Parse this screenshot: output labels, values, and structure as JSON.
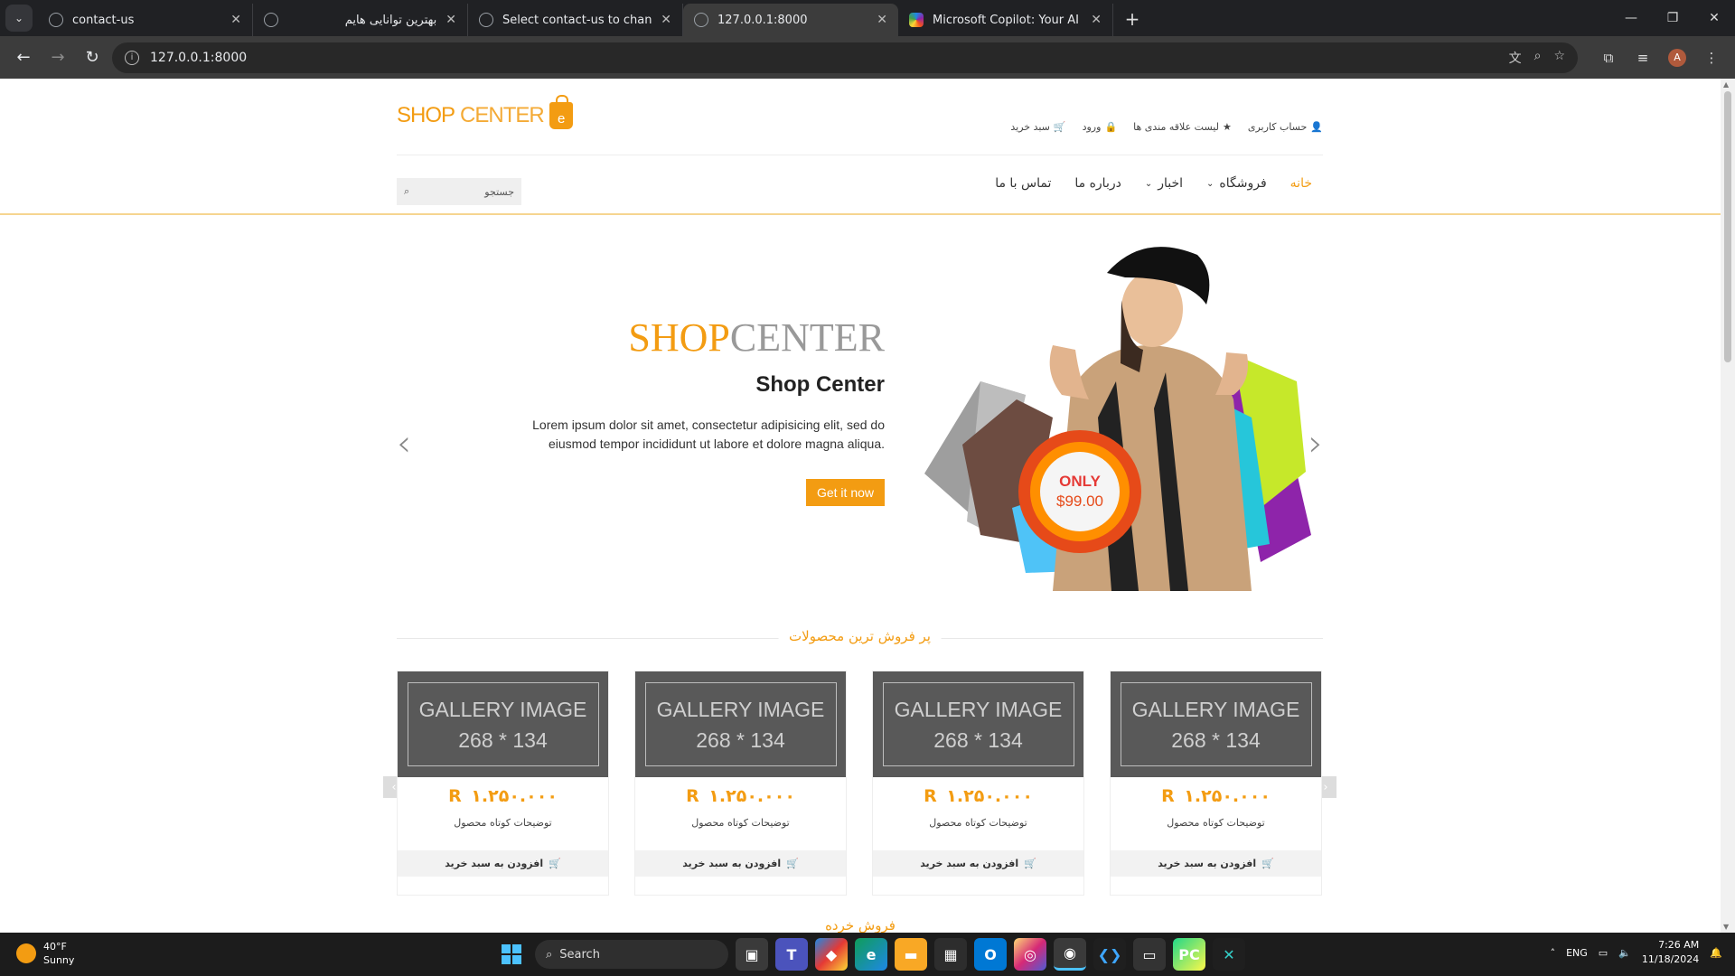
{
  "browser": {
    "tabs": [
      {
        "title": "contact-us",
        "active": false,
        "icon": "globe-icon"
      },
      {
        "title": "بهترین توانایی هایم",
        "active": false,
        "icon": "chatgpt-icon"
      },
      {
        "title": "Select contact-us to change | D",
        "active": false,
        "icon": "globe-icon"
      },
      {
        "title": "127.0.0.1:8000",
        "active": true,
        "icon": "globe-icon"
      },
      {
        "title": "Microsoft Copilot: Your AI comp",
        "active": false,
        "icon": "copilot-icon"
      }
    ],
    "url": "127.0.0.1:8000",
    "profile_initial": "A"
  },
  "header": {
    "logo_shop": "SHOP",
    "logo_center": "CENTER",
    "logo_bag_letter": "e",
    "top_links": [
      {
        "label": "حساب کاربری",
        "icon": "user-icon"
      },
      {
        "label": "لیست علاقه مندی ها",
        "icon": "star-icon"
      },
      {
        "label": "ورود",
        "icon": "lock-icon"
      },
      {
        "label": "سبد خرید",
        "icon": "cart-icon"
      }
    ]
  },
  "nav": {
    "items": [
      {
        "label": "خانه",
        "active": true,
        "dropdown": false
      },
      {
        "label": "فروشگاه",
        "active": false,
        "dropdown": true
      },
      {
        "label": "اخبار",
        "active": false,
        "dropdown": true
      },
      {
        "label": "درباره ما",
        "active": false,
        "dropdown": false
      },
      {
        "label": "تماس با ما",
        "active": false,
        "dropdown": false
      }
    ],
    "search_placeholder": "جستجو"
  },
  "hero": {
    "brand_shop": "SHOP",
    "brand_center": "CENTER",
    "subtitle": "Shop Center",
    "description": "Lorem ipsum dolor sit amet, consectetur adipisicing elit, sed do eiusmod tempor incididunt ut labore et dolore magna aliqua.",
    "button": "Get it now",
    "badge_top": "ONLY",
    "badge_price": "$99.00",
    "slide_count": 2,
    "active_slide": 2
  },
  "products_section": {
    "title": "پر فروش ترین محصولات",
    "items": [
      {
        "image_line1": "GALLERY IMAGE",
        "image_line2": "268 * 134",
        "price": "R ۱.۲۵۰.۰۰۰",
        "desc": "توضیحات کوتاه محصول",
        "add": "افزودن به سبد خرید"
      },
      {
        "image_line1": "GALLERY IMAGE",
        "image_line2": "268 * 134",
        "price": "R ۱.۲۵۰.۰۰۰",
        "desc": "توضیحات کوتاه محصول",
        "add": "افزودن به سبد خرید"
      },
      {
        "image_line1": "GALLERY IMAGE",
        "image_line2": "268 * 134",
        "price": "R ۱.۲۵۰.۰۰۰",
        "desc": "توضیحات کوتاه محصول",
        "add": "افزودن به سبد خرید"
      },
      {
        "image_line1": "GALLERY IMAGE",
        "image_line2": "268 * 134",
        "price": "R ۱.۲۵۰.۰۰۰",
        "desc": "توضیحات کوتاه محصول",
        "add": "افزودن به سبد خرید"
      }
    ]
  },
  "next_section_title": "فروش خرده",
  "taskbar": {
    "weather_temp": "40°F",
    "weather_cond": "Sunny",
    "search_label": "Search",
    "lang": "ENG",
    "time": "7:26 AM",
    "date": "11/18/2024"
  },
  "colors": {
    "accent": "#f39c12",
    "chrome_dark": "#202124",
    "image_placeholder": "#595959"
  }
}
